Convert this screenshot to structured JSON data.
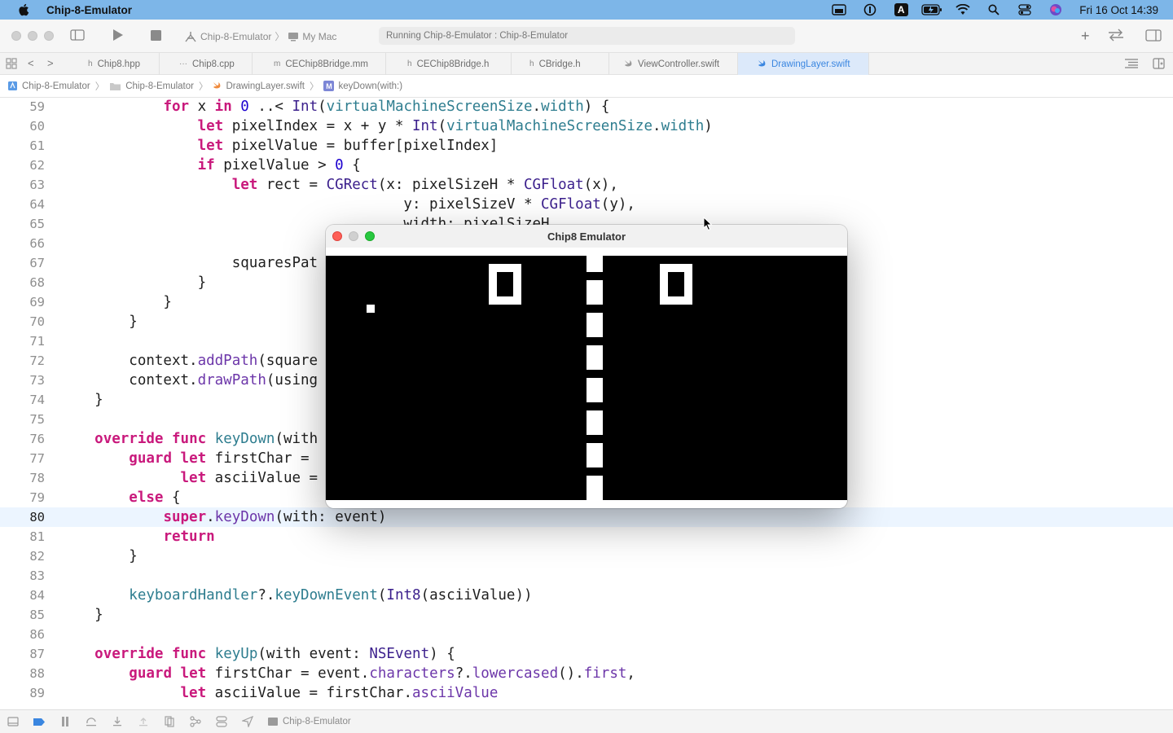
{
  "menubar": {
    "app_name": "Chip-8-Emulator",
    "clock": "Fri 16 Oct  14:39",
    "status_icons": [
      "finder-window-icon",
      "password-manager-icon",
      "input-source-icon",
      "battery-icon",
      "wifi-icon",
      "spotlight-search-icon",
      "control-center-icon",
      "siri-icon"
    ],
    "input_source_label": "A"
  },
  "toolbar": {
    "scheme_target": "Chip-8-Emulator",
    "scheme_destination": "My Mac",
    "activity_text": "Running Chip-8-Emulator : Chip-8-Emulator"
  },
  "tabs": [
    {
      "label": "Chip8.hpp",
      "icon": "h"
    },
    {
      "label": "Chip8.cpp",
      "icon": "···"
    },
    {
      "label": "CEChip8Bridge.mm",
      "icon": "m"
    },
    {
      "label": "CEChip8Bridge.h",
      "icon": "h"
    },
    {
      "label": "CBridge.h",
      "icon": "h"
    },
    {
      "label": "ViewController.swift",
      "icon": "swift"
    },
    {
      "label": "DrawingLayer.swift",
      "icon": "swift",
      "active": true
    }
  ],
  "jumpbar": {
    "project": "Chip-8-Emulator",
    "group": "Chip-8-Emulator",
    "file": "DrawingLayer.swift",
    "method_badge": "M",
    "method": "keyDown(with:)"
  },
  "editor": {
    "current_line": 80,
    "lines": [
      {
        "n": "59"
      },
      {
        "n": "60"
      },
      {
        "n": "61"
      },
      {
        "n": "62"
      },
      {
        "n": "63"
      },
      {
        "n": "64"
      },
      {
        "n": "65"
      },
      {
        "n": "66"
      },
      {
        "n": "67"
      },
      {
        "n": "68"
      },
      {
        "n": "69"
      },
      {
        "n": "70"
      },
      {
        "n": "71"
      },
      {
        "n": "72"
      },
      {
        "n": "73"
      },
      {
        "n": "74"
      },
      {
        "n": "75"
      },
      {
        "n": "76"
      },
      {
        "n": "77"
      },
      {
        "n": "78"
      },
      {
        "n": "79"
      },
      {
        "n": "80"
      },
      {
        "n": "81"
      },
      {
        "n": "82"
      },
      {
        "n": "83"
      },
      {
        "n": "84"
      },
      {
        "n": "85"
      },
      {
        "n": "86"
      },
      {
        "n": "87"
      },
      {
        "n": "88"
      },
      {
        "n": "89"
      }
    ],
    "code": {
      "l59": {
        "a": "            ",
        "kw1": "for",
        "b": " x ",
        "kw2": "in",
        "c": " ",
        "n1": "0",
        "d": " ..< ",
        "t1": "Int",
        "e": "(",
        "p1": "virtualMachineScreenSize",
        "f": ".",
        "p2": "width",
        "g": ") {"
      },
      "l60": {
        "a": "                ",
        "kw1": "let",
        "b": " pixelIndex = x + y * ",
        "t1": "Int",
        "c": "(",
        "p1": "virtualMachineScreenSize",
        "d": ".",
        "p2": "width",
        "e": ")"
      },
      "l61": {
        "a": "                ",
        "kw1": "let",
        "b": " pixelValue = buffer[pixelIndex]"
      },
      "l62": {
        "a": "                ",
        "kw1": "if",
        "b": " pixelValue > ",
        "n1": "0",
        "c": " {"
      },
      "l63": {
        "a": "                    ",
        "kw1": "let",
        "b": " rect = ",
        "t1": "CGRect",
        "c": "(x: pixelSizeH * ",
        "t2": "CGFloat",
        "d": "(x),"
      },
      "l64": {
        "a": "                                        y: pixelSizeV * ",
        "t1": "CGFloat",
        "b": "(y),"
      },
      "l65": {
        "a": "                                        width: pixelSizeH,"
      },
      "l67": {
        "a": "                    squaresPat"
      },
      "l68": {
        "a": "                }"
      },
      "l69": {
        "a": "            }"
      },
      "l70": {
        "a": "        }"
      },
      "l72": {
        "a": "        context.",
        "p1": "addPath",
        "b": "(square"
      },
      "l73": {
        "a": "        context.",
        "p1": "drawPath",
        "b": "(using"
      },
      "l74": {
        "a": "    }"
      },
      "l76": {
        "a": "    ",
        "kw1": "override",
        "b": " ",
        "kw2": "func",
        "c": " ",
        "f1": "keyDown",
        "d": "(with"
      },
      "l77": {
        "a": "        ",
        "kw1": "guard",
        "b": " ",
        "kw2": "let",
        "c": " firstChar ="
      },
      "l78": {
        "a": "              ",
        "kw1": "let",
        "b": " asciiValue ="
      },
      "l79": {
        "a": "        ",
        "kw1": "else",
        "b": " {"
      },
      "l80": {
        "a": "            ",
        "kw1": "super",
        "b": ".",
        "p1": "keyDown",
        "c": "(with: event)"
      },
      "l81": {
        "a": "            ",
        "kw1": "return"
      },
      "l82": {
        "a": "        }"
      },
      "l84": {
        "a": "        ",
        "f1": "keyboardHandler",
        "b": "?.",
        "p1": "keyDownEvent",
        "c": "(",
        "t1": "Int8",
        "d": "(asciiValue))"
      },
      "l85": {
        "a": "    }"
      },
      "l87": {
        "a": "    ",
        "kw1": "override",
        "b": " ",
        "kw2": "func",
        "c": " ",
        "f1": "keyUp",
        "d": "(with event: ",
        "t1": "NSEvent",
        "e": ") {"
      },
      "l88": {
        "a": "        ",
        "kw1": "guard",
        "b": " ",
        "kw2": "let",
        "c": " firstChar = event.",
        "p1": "characters",
        "d": "?.",
        "p2": "lowercased",
        "e": "().",
        "p3": "first",
        "f": ","
      },
      "l89": {
        "a": "              ",
        "kw1": "let",
        "b": " asciiValue = firstChar.",
        "p1": "asciiValue"
      }
    }
  },
  "statusbar": {
    "target": "Chip-8-Emulator"
  },
  "emulator": {
    "title": "Chip8 Emulator",
    "colors": {
      "background": "#000000",
      "pixel": "#ffffff",
      "close": "#fe5f57",
      "minimize": "#d0d0d0",
      "zoom": "#28c840"
    }
  }
}
